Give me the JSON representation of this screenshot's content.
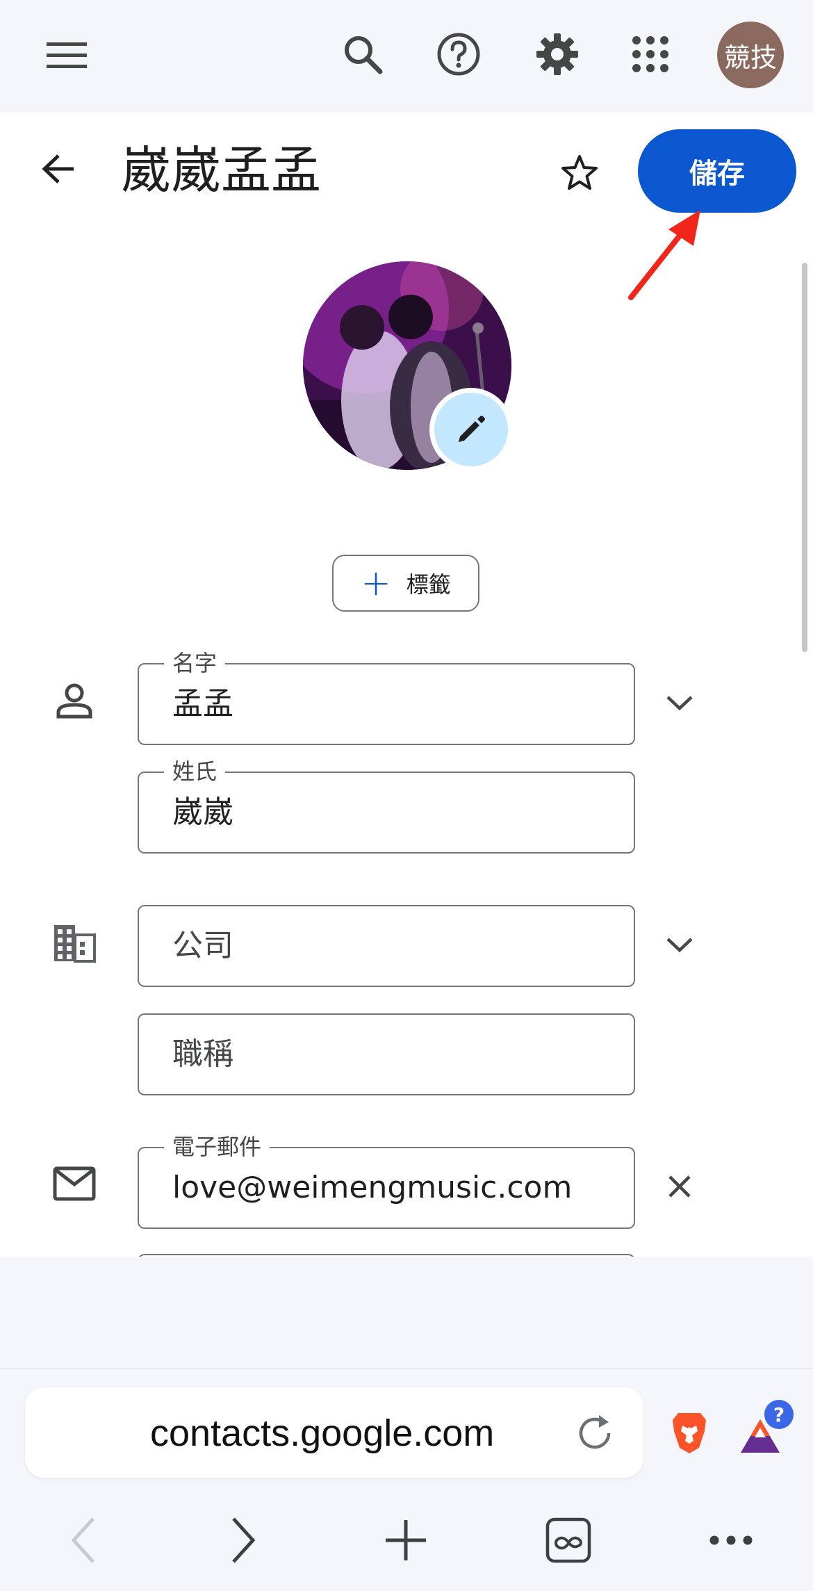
{
  "topbar": {
    "icons": [
      "menu-icon",
      "search-icon",
      "help-icon",
      "settings-icon",
      "apps-icon"
    ],
    "account_avatar_text": "競技"
  },
  "header": {
    "title": "崴崴孟孟",
    "save_label": "儲存"
  },
  "labels_chip": {
    "label": "標籤"
  },
  "fields": {
    "first_name": {
      "label": "名字",
      "value": "孟孟"
    },
    "last_name": {
      "label": "姓氏",
      "value": "崴崴"
    },
    "company": {
      "placeholder": "公司"
    },
    "job_title": {
      "placeholder": "職稱"
    },
    "email": {
      "label": "電子郵件",
      "value": "love@weimengmusic.com"
    }
  },
  "browser": {
    "url": "contacts.google.com",
    "rewards_badge": "?"
  },
  "colors": {
    "accent": "#0b57d0",
    "annotation_arrow": "#f0261b",
    "topbar_bg": "#f4f6f9"
  }
}
